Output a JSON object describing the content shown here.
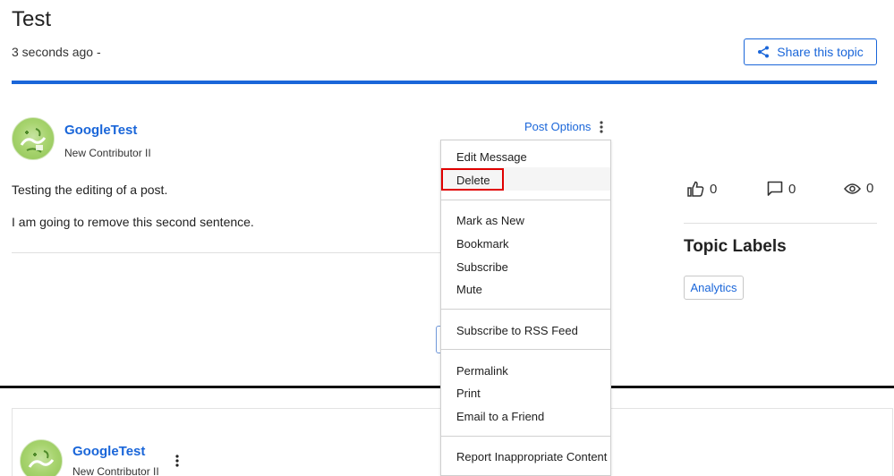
{
  "topic": {
    "title": "Test",
    "timestamp": "3 seconds ago -",
    "share_label": "Share this topic"
  },
  "post": {
    "author": "GoogleTest",
    "rank": "New Contributor II",
    "line1": "Testing the editing of a post.",
    "line2": "I am going to remove this second sentence.",
    "options_label": "Post Options"
  },
  "menu": {
    "items": [
      "Edit Message",
      "Delete",
      "Mark as New",
      "Bookmark",
      "Subscribe",
      "Mute",
      "Subscribe to RSS Feed",
      "Permalink",
      "Print",
      "Email to a Friend",
      "Report Inappropriate Content"
    ],
    "highlighted": "Delete"
  },
  "stats": {
    "likes": "0",
    "replies": "0",
    "views": "0"
  },
  "sidebar": {
    "labels_title": "Topic Labels",
    "labels": [
      "Analytics"
    ]
  },
  "reply": {
    "author": "GoogleTest",
    "rank": "New Contributor II"
  },
  "colors": {
    "accent": "#1a66d9",
    "highlight_box": "#e00000",
    "avatar_green": "#a8d46f"
  },
  "icons": {
    "share": "share-icon",
    "kebab": "kebab-menu-icon",
    "kudos": "thumbs-up-icon",
    "replies": "comment-icon",
    "views": "eye-icon"
  }
}
